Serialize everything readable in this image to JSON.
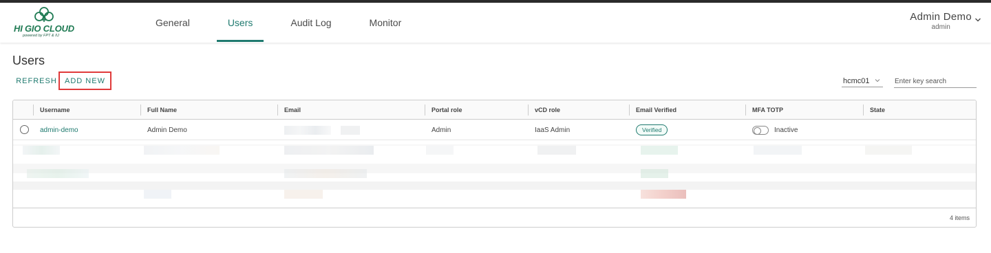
{
  "brand": {
    "name": "HI GIO CLOUD",
    "tagline": "powered by FPT & IIJ",
    "color": "#1f7a53"
  },
  "nav": {
    "tabs": [
      {
        "label": "General",
        "active": false
      },
      {
        "label": "Users",
        "active": true
      },
      {
        "label": "Audit Log",
        "active": false
      },
      {
        "label": "Monitor",
        "active": false
      }
    ]
  },
  "user_menu": {
    "name": "Admin Demo",
    "role": "admin",
    "icon": "chevron-down-icon"
  },
  "page": {
    "title": "Users"
  },
  "toolbar": {
    "refresh_label": "REFRESH",
    "add_new_label": "ADD NEW",
    "site_select": {
      "value": "hcmc01"
    },
    "search": {
      "placeholder": "Enter key search",
      "value": ""
    }
  },
  "table": {
    "columns": [
      "Username",
      "Full Name",
      "Email",
      "Portal role",
      "vCD role",
      "Email Verified",
      "MFA TOTP",
      "State"
    ],
    "rows": [
      {
        "username": "admin-demo",
        "full_name": "Admin Demo",
        "email": "",
        "portal_role": "Admin",
        "vcd_role": "IaaS Admin",
        "email_verified": "Verified",
        "mfa_totp": "Inactive",
        "state": ""
      }
    ],
    "footer": "4 items"
  },
  "colors": {
    "accent": "#1f7a6f",
    "highlight_border": "#e03a3a",
    "header_edge": "#2b2b2b"
  }
}
